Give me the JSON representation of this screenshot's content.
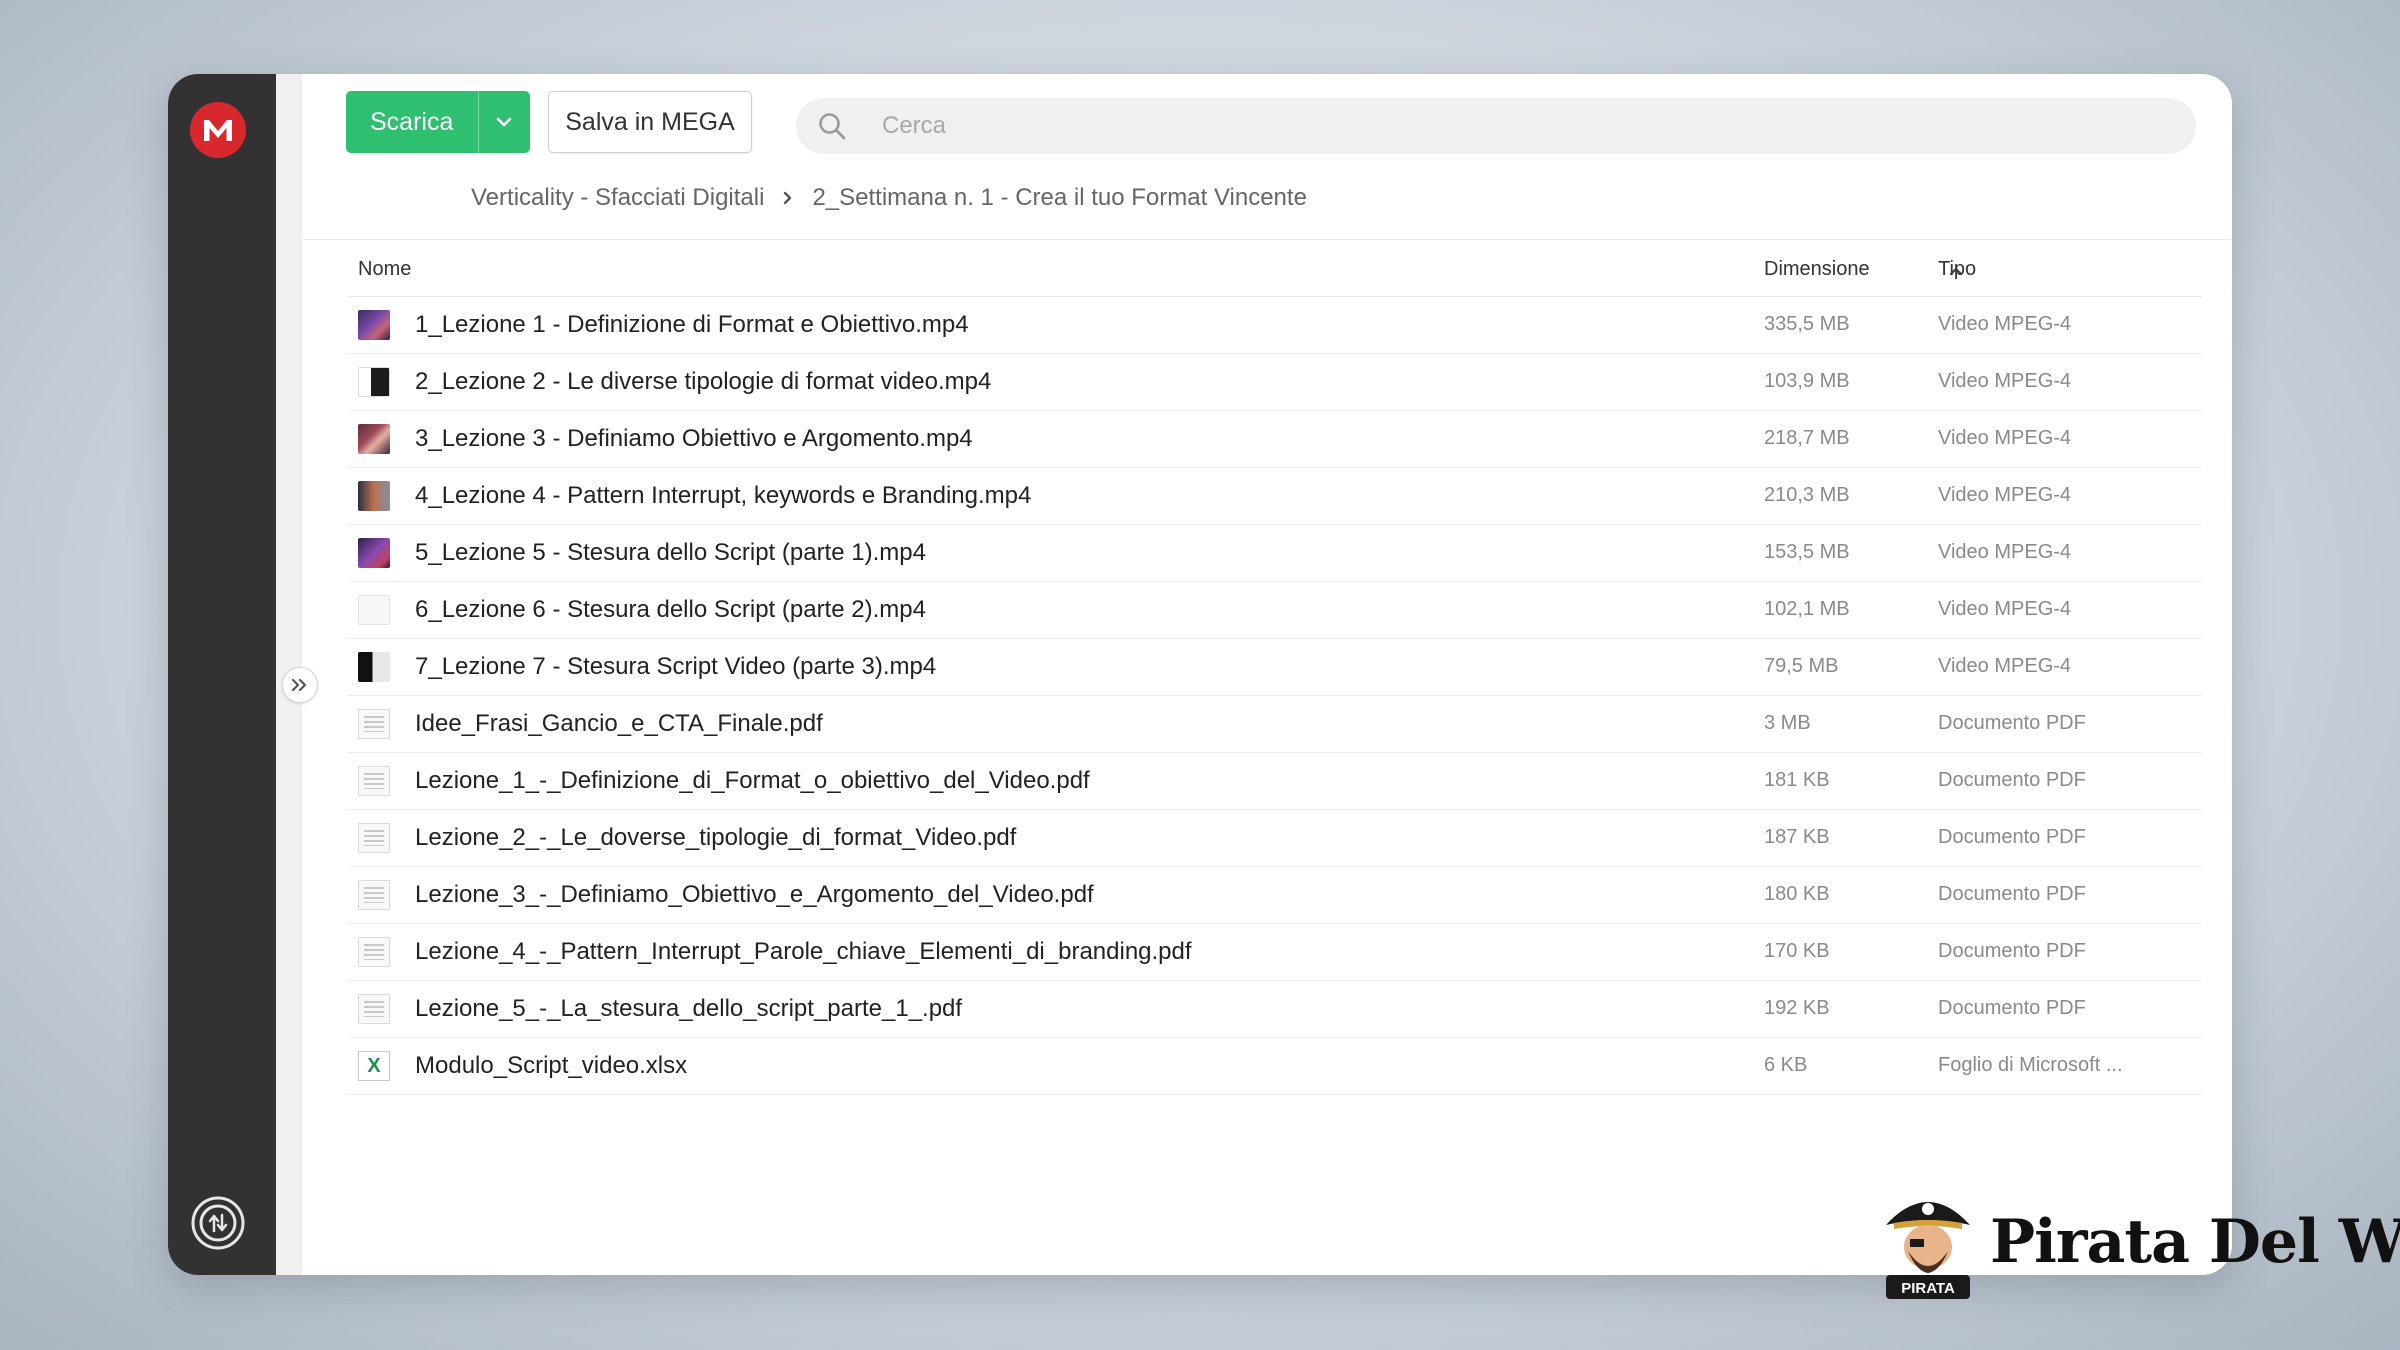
{
  "toolbar": {
    "download_label": "Scarica",
    "save_label": "Salva in MEGA"
  },
  "search": {
    "placeholder": "Cerca"
  },
  "breadcrumb": {
    "items": [
      "Verticality - Sfacciati Digitali",
      "2_Settimana n. 1 - Crea il tuo Format Vincente"
    ]
  },
  "table": {
    "headers": {
      "name": "Nome",
      "size": "Dimensione",
      "type": "Tipo"
    },
    "rows": [
      {
        "name": "1_Lezione 1 - Definizione di Format e Obiettivo.mp4",
        "size": "335,5 MB",
        "type": "Video MPEG-4",
        "icon": "video-thumbnail"
      },
      {
        "name": "2_Lezione 2 - Le diverse tipologie di format video.mp4",
        "size": "103,9 MB",
        "type": "Video MPEG-4",
        "icon": "video-thumbnail"
      },
      {
        "name": "3_Lezione 3 - Definiamo Obiettivo e Argomento.mp4",
        "size": "218,7 MB",
        "type": "Video MPEG-4",
        "icon": "video-thumbnail"
      },
      {
        "name": "4_Lezione 4 - Pattern Interrupt, keywords e Branding.mp4",
        "size": "210,3 MB",
        "type": "Video MPEG-4",
        "icon": "video-thumbnail"
      },
      {
        "name": "5_Lezione 5 - Stesura dello Script (parte 1).mp4",
        "size": "153,5 MB",
        "type": "Video MPEG-4",
        "icon": "video-thumbnail"
      },
      {
        "name": "6_Lezione 6 - Stesura dello Script (parte 2).mp4",
        "size": "102,1 MB",
        "type": "Video MPEG-4",
        "icon": "video-thumbnail"
      },
      {
        "name": "7_Lezione 7 - Stesura Script Video (parte 3).mp4",
        "size": "79,5 MB",
        "type": "Video MPEG-4",
        "icon": "video-thumbnail"
      },
      {
        "name": "Idee_Frasi_Gancio_e_CTA_Finale.pdf",
        "size": "3 MB",
        "type": "Documento PDF",
        "icon": "pdf-thumbnail"
      },
      {
        "name": "Lezione_1_-_Definizione_di_Format_o_obiettivo_del_Video.pdf",
        "size": "181 KB",
        "type": "Documento PDF",
        "icon": "pdf-thumbnail"
      },
      {
        "name": "Lezione_2_-_Le_doverse_tipologie_di_format_Video.pdf",
        "size": "187 KB",
        "type": "Documento PDF",
        "icon": "pdf-thumbnail"
      },
      {
        "name": "Lezione_3_-_Definiamo_Obiettivo_e_Argomento_del_Video.pdf",
        "size": "180 KB",
        "type": "Documento PDF",
        "icon": "pdf-thumbnail"
      },
      {
        "name": "Lezione_4_-_Pattern_Interrupt_Parole_chiave_Elementi_di_branding.pdf",
        "size": "170 KB",
        "type": "Documento PDF",
        "icon": "pdf-thumbnail"
      },
      {
        "name": "Lezione_5_-_La_stesura_dello_script_parte_1_.pdf",
        "size": "192 KB",
        "type": "Documento PDF",
        "icon": "pdf-thumbnail"
      },
      {
        "name": "Modulo_Script_video.xlsx",
        "size": "6 KB",
        "type": "Foglio di Microsoft ...",
        "icon": "excel-file-icon"
      }
    ]
  },
  "watermark": {
    "text": "Pirata Del Web",
    "badge_text": "PIRATA"
  },
  "colors": {
    "accent_green": "#2fbf71",
    "mega_red": "#d9272e",
    "sidebar_dark": "#323232"
  }
}
